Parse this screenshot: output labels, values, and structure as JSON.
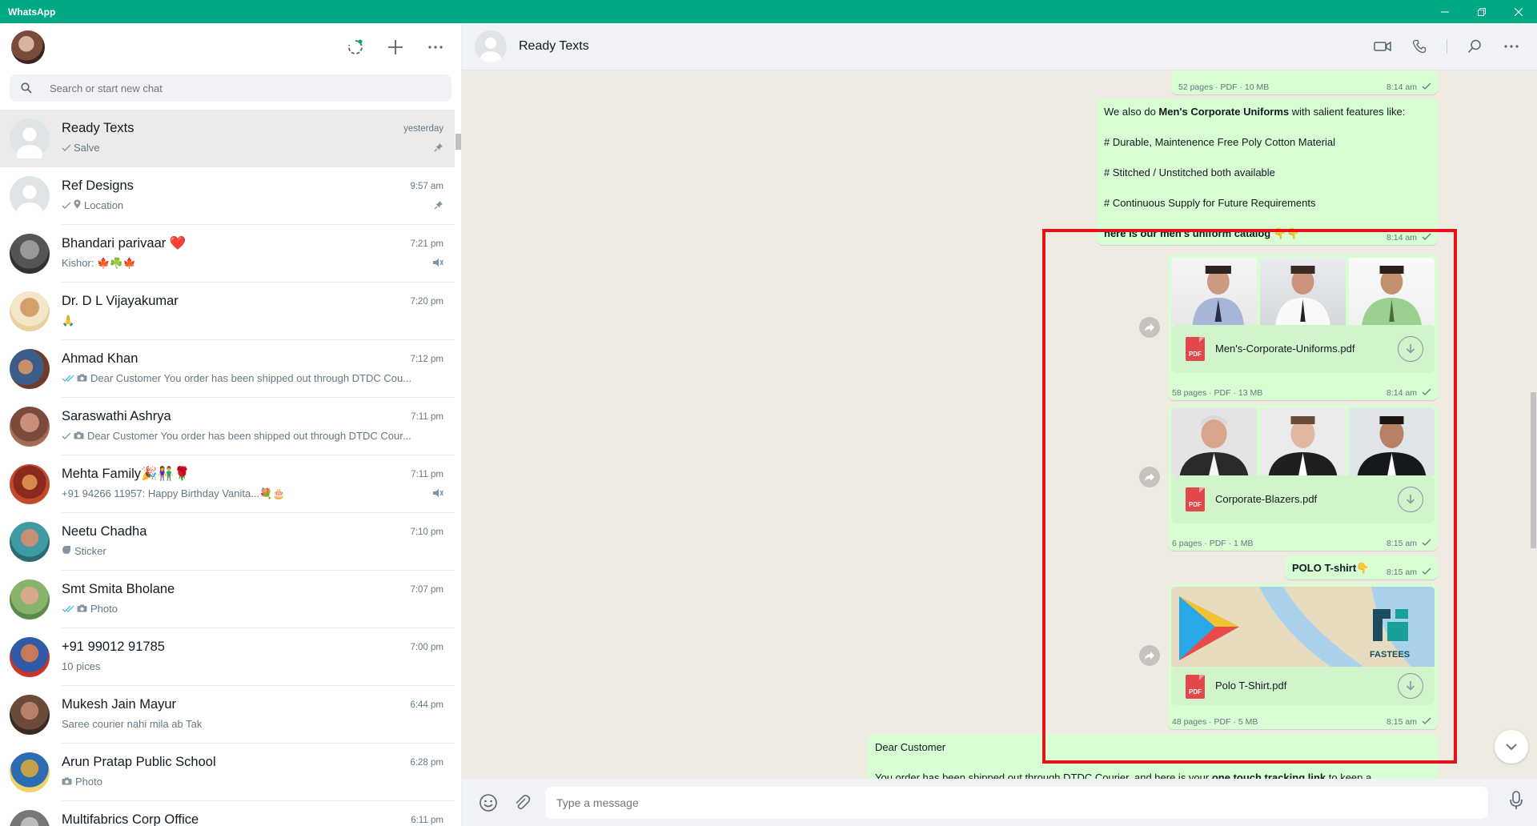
{
  "app": {
    "title": "WhatsApp"
  },
  "left_header": {},
  "search": {
    "placeholder": "Search or start new chat"
  },
  "chats": [
    {
      "name": "Ready Texts",
      "time": "yesterday",
      "preview": "Salve",
      "tick": "single",
      "badge": "pin"
    },
    {
      "name": "Ref Designs",
      "time": "9:57 am",
      "preview": "Location",
      "tick": "single",
      "badge": "pin"
    },
    {
      "name": "Bhandari parivaar ❤️",
      "time": "7:21 pm",
      "preview": "Kishor: 🍁☘️🍁",
      "tick": "",
      "badge": "mute"
    },
    {
      "name": "Dr. D L Vijayakumar",
      "time": "7:20 pm",
      "preview": "🙏",
      "tick": "",
      "badge": ""
    },
    {
      "name": "Ahmad Khan",
      "time": "7:12 pm",
      "preview": "Dear Customer  You order has been shipped out through DTDC Cou...",
      "tick": "double",
      "badge": ""
    },
    {
      "name": "Saraswathi Ashrya",
      "time": "7:11 pm",
      "preview": "Dear Customer  You order has been shipped out through DTDC Cour...",
      "tick": "single",
      "badge": ""
    },
    {
      "name": "Mehta Family🎉👫🌹",
      "time": "7:11 pm",
      "preview": "+91 94266 11957: Happy Birthday Vanita...💐🎂",
      "tick": "",
      "badge": "mute"
    },
    {
      "name": "Neetu Chadha",
      "time": "7:10 pm",
      "preview": "Sticker",
      "tick": "",
      "badge": ""
    },
    {
      "name": "Smt Smita Bholane",
      "time": "7:07 pm",
      "preview": "Photo",
      "tick": "double",
      "badge": ""
    },
    {
      "name": "+91 99012 91785",
      "time": "7:00 pm",
      "preview": "10 pices",
      "tick": "",
      "badge": ""
    },
    {
      "name": "Mukesh Jain Mayur",
      "time": "6:44 pm",
      "preview": "Saree courier nahi mila ab Tak",
      "tick": "",
      "badge": ""
    },
    {
      "name": "Arun Pratap Public School",
      "time": "6:28 pm",
      "preview": "Photo",
      "tick": "",
      "badge": ""
    },
    {
      "name": "Multifabrics Corp Office",
      "time": "6:11 pm",
      "preview": "",
      "tick": "",
      "badge": ""
    }
  ],
  "conversation": {
    "name": "Ready Texts",
    "top_doc_meta": {
      "info": "52 pages · PDF · 10 MB",
      "time": "8:14 am"
    },
    "uniform_msg": {
      "line1_pre": "We also do ",
      "line1_bold": "Men's Corporate Uniforms",
      "line1_post": " with salient features like:",
      "line2": "# Durable, Maintenence Free Poly Cotton Material",
      "line3": "# Stitched / Unstitched both available",
      "line4": "# Continuous Supply for Future Requirements",
      "line5_bold": "here is our men's uniform catalog",
      "line5_emoji": "👇👇",
      "time": "8:14 am"
    },
    "docs": [
      {
        "name": "Men's-Corporate-Uniforms.pdf",
        "info": "58 pages · PDF · 13 MB",
        "time": "8:14 am"
      },
      {
        "name": "Corporate-Blazers.pdf",
        "info": "6 pages · PDF · 1 MB",
        "time": "8:15 am"
      },
      {
        "name": "Polo T-Shirt.pdf",
        "info": "48 pages · PDF · 5 MB",
        "time": "8:15 am"
      }
    ],
    "polo_msg": {
      "text_bold": "POLO T-shirt",
      "emoji": "👇",
      "time": "8:15 am"
    },
    "polo_logo_text": "FASTEES",
    "last_msg": {
      "line1": "Dear Customer",
      "line2_pre": "You order has been shipped out through DTDC Courier, and here is your ",
      "line2_bold": "one touch tracking link",
      "line2_post": " to keep a"
    },
    "pdf_label": "PDF"
  },
  "composer": {
    "placeholder": "Type a message"
  },
  "colors": {
    "brand": "#00a884",
    "outgoing_bubble": "#d9fdd3",
    "highlight": "#e4131a",
    "pdf_red": "#e2474b"
  }
}
